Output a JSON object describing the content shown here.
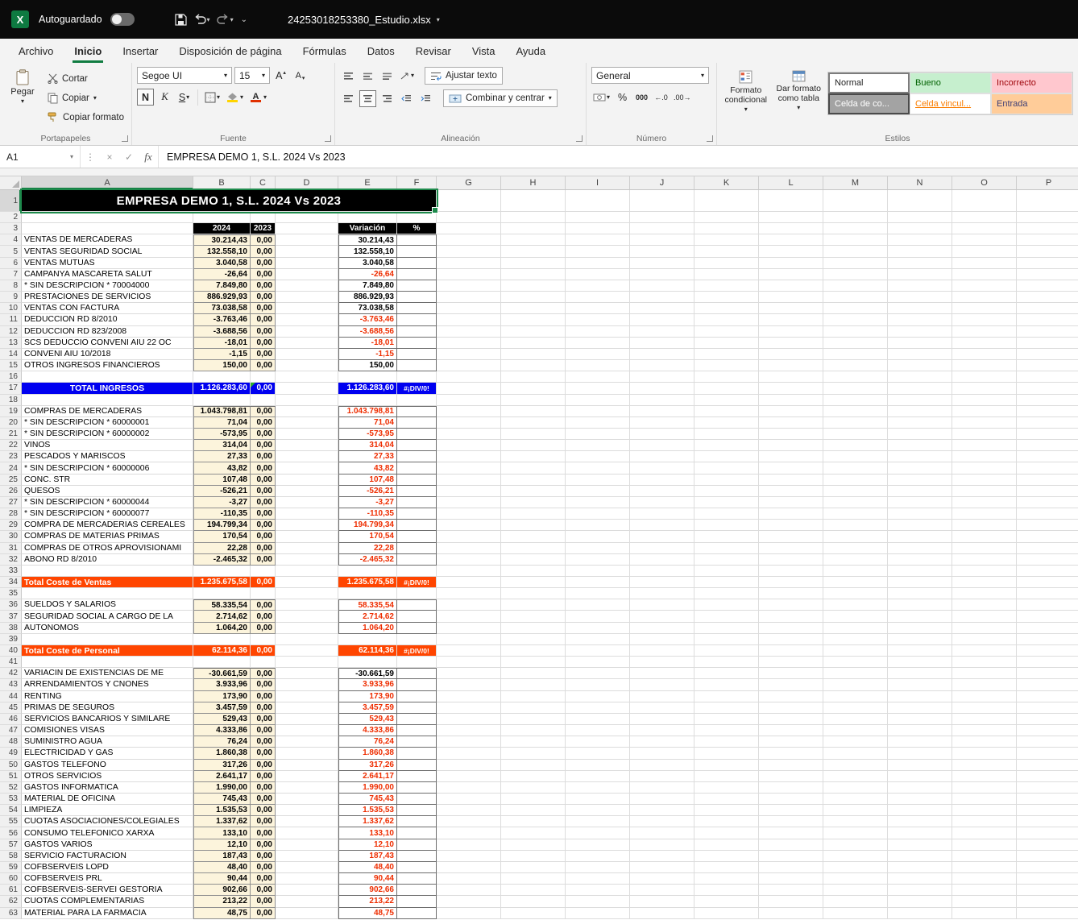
{
  "titlebar": {
    "autosave_label": "Autoguardado",
    "filename": "24253018253380_Estudio.xlsx"
  },
  "menu": {
    "tabs": [
      "Archivo",
      "Inicio",
      "Insertar",
      "Disposición de página",
      "Fórmulas",
      "Datos",
      "Revisar",
      "Vista",
      "Ayuda"
    ],
    "active_tab": "Inicio"
  },
  "ribbon": {
    "groups": {
      "clipboard": {
        "label": "Portapapeles",
        "paste": "Pegar",
        "cut": "Cortar",
        "copy": "Copiar",
        "format_painter": "Copiar formato"
      },
      "font": {
        "label": "Fuente",
        "family": "Segoe UI",
        "size": "15",
        "bold": "N",
        "italic": "K",
        "underline": "S"
      },
      "alignment": {
        "label": "Alineación",
        "wrap": "Ajustar texto",
        "merge": "Combinar y centrar"
      },
      "number": {
        "label": "Número",
        "format": "General",
        "pct": "%",
        "thousands": "000"
      },
      "styles": {
        "label": "Estilos",
        "conditional": "Formato condicional",
        "as_table": "Dar formato como tabla",
        "cells": [
          "Normal",
          "Bueno",
          "Incorrecto",
          "Celda de co...",
          "Celda vincul...",
          "Entrada"
        ]
      }
    }
  },
  "formula_bar": {
    "name_box": "A1",
    "fx": "fx",
    "formula": "EMPRESA DEMO 1, S.L. 2024 Vs 2023"
  },
  "colors": {
    "accent_green": "#107C41",
    "total_blue": "#0000F0",
    "total_orange": "#FF4500",
    "cell_fill_beige": "#FCF4DC",
    "negative_red": "#EE2D00"
  },
  "grid": {
    "columns": [
      "A",
      "B",
      "C",
      "D",
      "E",
      "F",
      "G",
      "H",
      "I",
      "J",
      "K",
      "L",
      "M",
      "N",
      "O",
      "P"
    ],
    "title": "EMPRESA DEMO 1, S.L. 2024 Vs 2023",
    "headers": {
      "y2024": "2024",
      "y2023": "2023",
      "variation": "Variación",
      "pct": "%"
    },
    "rows": [
      {
        "n": 1,
        "t": "title"
      },
      {
        "n": 2,
        "t": "e"
      },
      {
        "n": 3,
        "t": "head"
      },
      {
        "n": 4,
        "t": "d",
        "a": "VENTAS DE MERCADERAS",
        "b": "30.214,43",
        "c": "0,00",
        "e": "30.214,43",
        "red": false
      },
      {
        "n": 5,
        "t": "d",
        "a": "VENTAS SEGURIDAD SOCIAL",
        "b": "132.558,10",
        "c": "0,00",
        "e": "132.558,10",
        "red": false
      },
      {
        "n": 6,
        "t": "d",
        "a": "VENTAS MUTUAS",
        "b": "3.040,58",
        "c": "0,00",
        "e": "3.040,58",
        "red": false
      },
      {
        "n": 7,
        "t": "d",
        "a": "CAMPANYA MASCARETA SALUT",
        "b": "-26,64",
        "c": "0,00",
        "e": "-26,64",
        "red": true
      },
      {
        "n": 8,
        "t": "d",
        "a": "* SIN DESCRIPCION *  70004000",
        "b": "7.849,80",
        "c": "0,00",
        "e": "7.849,80",
        "red": false
      },
      {
        "n": 9,
        "t": "d",
        "a": "PRESTACIONES DE SERVICIOS",
        "b": "886.929,93",
        "c": "0,00",
        "e": "886.929,93",
        "red": false
      },
      {
        "n": 10,
        "t": "d",
        "a": "VENTAS CON FACTURA",
        "b": "73.038,58",
        "c": "0,00",
        "e": "73.038,58",
        "red": false
      },
      {
        "n": 11,
        "t": "d",
        "a": "DEDUCCION RD 8/2010",
        "b": "-3.763,46",
        "c": "0,00",
        "e": "-3.763,46",
        "red": true
      },
      {
        "n": 12,
        "t": "d",
        "a": "DEDUCCION RD 823/2008",
        "b": "-3.688,56",
        "c": "0,00",
        "e": "-3.688,56",
        "red": true
      },
      {
        "n": 13,
        "t": "d",
        "a": "SCS DEDUCCIO CONVENI AIU 22 OC",
        "b": "-18,01",
        "c": "0,00",
        "e": "-18,01",
        "red": true
      },
      {
        "n": 14,
        "t": "d",
        "a": "CONVENI AIU 10/2018",
        "b": "-1,15",
        "c": "0,00",
        "e": "-1,15",
        "red": true
      },
      {
        "n": 15,
        "t": "d",
        "a": "OTROS INGRESOS FINANCIEROS",
        "b": "150,00",
        "c": "0,00",
        "e": "150,00",
        "red": false
      },
      {
        "n": 16,
        "t": "e"
      },
      {
        "n": 17,
        "t": "blue",
        "a": "TOTAL INGRESOS",
        "b": "1.126.283,60",
        "c": "0,00",
        "e": "1.126.283,60",
        "f": "#¡DIV/0!"
      },
      {
        "n": 18,
        "t": "e"
      },
      {
        "n": 19,
        "t": "d",
        "a": "COMPRAS DE MERCADERAS",
        "b": "1.043.798,81",
        "c": "0,00",
        "e": "1.043.798,81",
        "red": true
      },
      {
        "n": 20,
        "t": "d",
        "a": "* SIN DESCRIPCION *  60000001",
        "b": "71,04",
        "c": "0,00",
        "e": "71,04",
        "red": true
      },
      {
        "n": 21,
        "t": "d",
        "a": "* SIN DESCRIPCION *  60000002",
        "b": "-573,95",
        "c": "0,00",
        "e": "-573,95",
        "red": true
      },
      {
        "n": 22,
        "t": "d",
        "a": "VINOS",
        "b": "314,04",
        "c": "0,00",
        "e": "314,04",
        "red": true
      },
      {
        "n": 23,
        "t": "d",
        "a": "PESCADOS Y MARISCOS",
        "b": "27,33",
        "c": "0,00",
        "e": "27,33",
        "red": true
      },
      {
        "n": 24,
        "t": "d",
        "a": "* SIN DESCRIPCION *  60000006",
        "b": "43,82",
        "c": "0,00",
        "e": "43,82",
        "red": true
      },
      {
        "n": 25,
        "t": "d",
        "a": "CONC. STR",
        "b": "107,48",
        "c": "0,00",
        "e": "107,48",
        "red": true
      },
      {
        "n": 26,
        "t": "d",
        "a": "QUESOS",
        "b": "-526,21",
        "c": "0,00",
        "e": "-526,21",
        "red": true
      },
      {
        "n": 27,
        "t": "d",
        "a": "* SIN DESCRIPCION *  60000044",
        "b": "-3,27",
        "c": "0,00",
        "e": "-3,27",
        "red": true
      },
      {
        "n": 28,
        "t": "d",
        "a": "* SIN DESCRIPCION *  60000077",
        "b": "-110,35",
        "c": "0,00",
        "e": "-110,35",
        "red": true
      },
      {
        "n": 29,
        "t": "d",
        "a": "COMPRA DE MERCADERIAS CEREALES",
        "b": "194.799,34",
        "c": "0,00",
        "e": "194.799,34",
        "red": true
      },
      {
        "n": 30,
        "t": "d",
        "a": "COMPRAS DE MATERIAS PRIMAS",
        "b": "170,54",
        "c": "0,00",
        "e": "170,54",
        "red": true
      },
      {
        "n": 31,
        "t": "d",
        "a": "COMPRAS DE OTROS APROVISIONAMI",
        "b": "22,28",
        "c": "0,00",
        "e": "22,28",
        "red": true
      },
      {
        "n": 32,
        "t": "d",
        "a": "ABONO RD 8/2010",
        "b": "-2.465,32",
        "c": "0,00",
        "e": "-2.465,32",
        "red": true
      },
      {
        "n": 33,
        "t": "e"
      },
      {
        "n": 34,
        "t": "orange",
        "a": "Total Coste de Ventas",
        "b": "1.235.675,58",
        "c": "0,00",
        "e": "1.235.675,58",
        "f": "#¡DIV/0!"
      },
      {
        "n": 35,
        "t": "e"
      },
      {
        "n": 36,
        "t": "d",
        "a": "SUELDOS Y SALARIOS",
        "b": "58.335,54",
        "c": "0,00",
        "e": "58.335,54",
        "red": true
      },
      {
        "n": 37,
        "t": "d",
        "a": "SEGURIDAD SOCIAL A CARGO DE LA",
        "b": "2.714,62",
        "c": "0,00",
        "e": "2.714,62",
        "red": true
      },
      {
        "n": 38,
        "t": "d",
        "a": "AUTONOMOS",
        "b": "1.064,20",
        "c": "0,00",
        "e": "1.064,20",
        "red": true
      },
      {
        "n": 39,
        "t": "e"
      },
      {
        "n": 40,
        "t": "orange",
        "a": "Total Coste de Personal",
        "b": "62.114,36",
        "c": "0,00",
        "e": "62.114,36",
        "f": "#¡DIV/0!"
      },
      {
        "n": 41,
        "t": "e"
      },
      {
        "n": 42,
        "t": "d",
        "a": "VARIACIN DE EXISTENCIAS DE ME",
        "b": "-30.661,59",
        "c": "0,00",
        "e": "-30.661,59",
        "red": false
      },
      {
        "n": 43,
        "t": "d",
        "a": "ARRENDAMIENTOS Y CNONES",
        "b": "3.933,96",
        "c": "0,00",
        "e": "3.933,96",
        "red": true
      },
      {
        "n": 44,
        "t": "d",
        "a": "RENTING",
        "b": "173,90",
        "c": "0,00",
        "e": "173,90",
        "red": true
      },
      {
        "n": 45,
        "t": "d",
        "a": "PRIMAS DE SEGUROS",
        "b": "3.457,59",
        "c": "0,00",
        "e": "3.457,59",
        "red": true
      },
      {
        "n": 46,
        "t": "d",
        "a": "SERVICIOS BANCARIOS Y SIMILARE",
        "b": "529,43",
        "c": "0,00",
        "e": "529,43",
        "red": true
      },
      {
        "n": 47,
        "t": "d",
        "a": "COMISIONES VISAS",
        "b": "4.333,86",
        "c": "0,00",
        "e": "4.333,86",
        "red": true
      },
      {
        "n": 48,
        "t": "d",
        "a": "SUMINISTRO AGUA",
        "b": "76,24",
        "c": "0,00",
        "e": "76,24",
        "red": true
      },
      {
        "n": 49,
        "t": "d",
        "a": "ELECTRICIDAD Y GAS",
        "b": "1.860,38",
        "c": "0,00",
        "e": "1.860,38",
        "red": true
      },
      {
        "n": 50,
        "t": "d",
        "a": "GASTOS TELEFONO",
        "b": "317,26",
        "c": "0,00",
        "e": "317,26",
        "red": true
      },
      {
        "n": 51,
        "t": "d",
        "a": "OTROS SERVICIOS",
        "b": "2.641,17",
        "c": "0,00",
        "e": "2.641,17",
        "red": true
      },
      {
        "n": 52,
        "t": "d",
        "a": "GASTOS INFORMATICA",
        "b": "1.990,00",
        "c": "0,00",
        "e": "1.990,00",
        "red": true
      },
      {
        "n": 53,
        "t": "d",
        "a": "MATERIAL DE OFICINA",
        "b": "745,43",
        "c": "0,00",
        "e": "745,43",
        "red": true
      },
      {
        "n": 54,
        "t": "d",
        "a": "LIMPIEZA",
        "b": "1.535,53",
        "c": "0,00",
        "e": "1.535,53",
        "red": true
      },
      {
        "n": 55,
        "t": "d",
        "a": "CUOTAS ASOCIACIONES/COLEGIALES",
        "b": "1.337,62",
        "c": "0,00",
        "e": "1.337,62",
        "red": true
      },
      {
        "n": 56,
        "t": "d",
        "a": "CONSUMO TELEFONICO XARXA",
        "b": "133,10",
        "c": "0,00",
        "e": "133,10",
        "red": true
      },
      {
        "n": 57,
        "t": "d",
        "a": "GASTOS VARIOS",
        "b": "12,10",
        "c": "0,00",
        "e": "12,10",
        "red": true
      },
      {
        "n": 58,
        "t": "d",
        "a": "SERVICIO FACTURACION",
        "b": "187,43",
        "c": "0,00",
        "e": "187,43",
        "red": true
      },
      {
        "n": 59,
        "t": "d",
        "a": "COFBSERVEIS LOPD",
        "b": "48,40",
        "c": "0,00",
        "e": "48,40",
        "red": true
      },
      {
        "n": 60,
        "t": "d",
        "a": "COFBSERVEIS PRL",
        "b": "90,44",
        "c": "0,00",
        "e": "90,44",
        "red": true
      },
      {
        "n": 61,
        "t": "d",
        "a": "COFBSERVEIS-SERVEI GESTORIA",
        "b": "902,66",
        "c": "0,00",
        "e": "902,66",
        "red": true
      },
      {
        "n": 62,
        "t": "d",
        "a": "CUOTAS COMPLEMENTARIAS",
        "b": "213,22",
        "c": "0,00",
        "e": "213,22",
        "red": true
      },
      {
        "n": 63,
        "t": "d",
        "a": "MATERIAL PARA LA FARMACIA",
        "b": "48,75",
        "c": "0,00",
        "e": "48,75",
        "red": true
      }
    ]
  }
}
